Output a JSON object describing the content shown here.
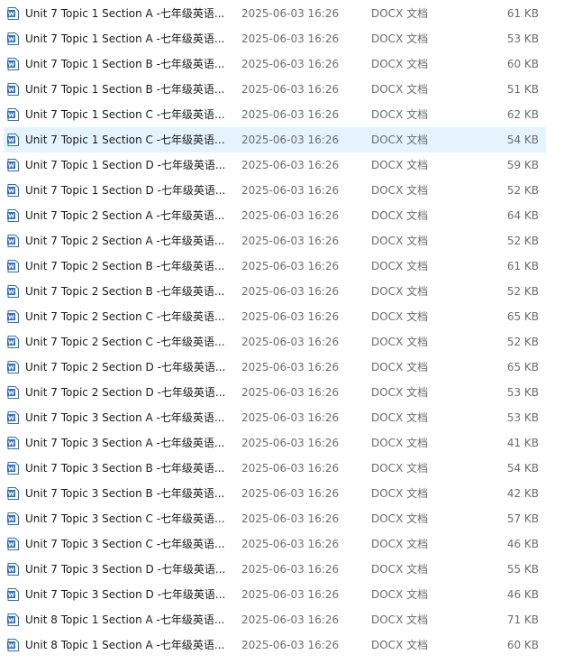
{
  "file_icon": "word-document-icon",
  "colors": {
    "selected_row": "#e5f3ff",
    "word_icon_blue": "#2b6cc4"
  },
  "files": [
    {
      "name": "Unit 7 Topic 1 Section A -七年级英语...",
      "date": "2025-06-03 16:26",
      "type": "DOCX 文档",
      "size": "61 KB",
      "selected": false
    },
    {
      "name": "Unit 7 Topic 1 Section A -七年级英语...",
      "date": "2025-06-03 16:26",
      "type": "DOCX 文档",
      "size": "53 KB",
      "selected": false
    },
    {
      "name": "Unit 7 Topic 1 Section B -七年级英语...",
      "date": "2025-06-03 16:26",
      "type": "DOCX 文档",
      "size": "60 KB",
      "selected": false
    },
    {
      "name": "Unit 7 Topic 1 Section B -七年级英语...",
      "date": "2025-06-03 16:26",
      "type": "DOCX 文档",
      "size": "51 KB",
      "selected": false
    },
    {
      "name": "Unit 7 Topic 1 Section C -七年级英语...",
      "date": "2025-06-03 16:26",
      "type": "DOCX 文档",
      "size": "62 KB",
      "selected": false
    },
    {
      "name": "Unit 7 Topic 1 Section C -七年级英语...",
      "date": "2025-06-03 16:26",
      "type": "DOCX 文档",
      "size": "54 KB",
      "selected": true
    },
    {
      "name": "Unit 7 Topic 1 Section D -七年级英语...",
      "date": "2025-06-03 16:26",
      "type": "DOCX 文档",
      "size": "59 KB",
      "selected": false
    },
    {
      "name": "Unit 7 Topic 1 Section D -七年级英语...",
      "date": "2025-06-03 16:26",
      "type": "DOCX 文档",
      "size": "52 KB",
      "selected": false
    },
    {
      "name": "Unit 7 Topic 2 Section A -七年级英语...",
      "date": "2025-06-03 16:26",
      "type": "DOCX 文档",
      "size": "64 KB",
      "selected": false
    },
    {
      "name": "Unit 7 Topic 2 Section A -七年级英语...",
      "date": "2025-06-03 16:26",
      "type": "DOCX 文档",
      "size": "52 KB",
      "selected": false
    },
    {
      "name": "Unit 7 Topic 2 Section B -七年级英语...",
      "date": "2025-06-03 16:26",
      "type": "DOCX 文档",
      "size": "61 KB",
      "selected": false
    },
    {
      "name": "Unit 7 Topic 2 Section B -七年级英语...",
      "date": "2025-06-03 16:26",
      "type": "DOCX 文档",
      "size": "52 KB",
      "selected": false
    },
    {
      "name": "Unit 7 Topic 2 Section C -七年级英语...",
      "date": "2025-06-03 16:26",
      "type": "DOCX 文档",
      "size": "65 KB",
      "selected": false
    },
    {
      "name": "Unit 7 Topic 2 Section C -七年级英语...",
      "date": "2025-06-03 16:26",
      "type": "DOCX 文档",
      "size": "52 KB",
      "selected": false
    },
    {
      "name": "Unit 7 Topic 2 Section D -七年级英语...",
      "date": "2025-06-03 16:26",
      "type": "DOCX 文档",
      "size": "65 KB",
      "selected": false
    },
    {
      "name": "Unit 7 Topic 2 Section D -七年级英语...",
      "date": "2025-06-03 16:26",
      "type": "DOCX 文档",
      "size": "53 KB",
      "selected": false
    },
    {
      "name": "Unit 7 Topic 3 Section A -七年级英语...",
      "date": "2025-06-03 16:26",
      "type": "DOCX 文档",
      "size": "53 KB",
      "selected": false
    },
    {
      "name": "Unit 7 Topic 3 Section A -七年级英语...",
      "date": "2025-06-03 16:26",
      "type": "DOCX 文档",
      "size": "41 KB",
      "selected": false
    },
    {
      "name": "Unit 7 Topic 3 Section B -七年级英语...",
      "date": "2025-06-03 16:26",
      "type": "DOCX 文档",
      "size": "54 KB",
      "selected": false
    },
    {
      "name": "Unit 7 Topic 3 Section B -七年级英语...",
      "date": "2025-06-03 16:26",
      "type": "DOCX 文档",
      "size": "42 KB",
      "selected": false
    },
    {
      "name": "Unit 7 Topic 3 Section C -七年级英语...",
      "date": "2025-06-03 16:26",
      "type": "DOCX 文档",
      "size": "57 KB",
      "selected": false
    },
    {
      "name": "Unit 7 Topic 3 Section C -七年级英语...",
      "date": "2025-06-03 16:26",
      "type": "DOCX 文档",
      "size": "46 KB",
      "selected": false
    },
    {
      "name": "Unit 7 Topic 3 Section D -七年级英语...",
      "date": "2025-06-03 16:26",
      "type": "DOCX 文档",
      "size": "55 KB",
      "selected": false
    },
    {
      "name": "Unit 7 Topic 3 Section D -七年级英语...",
      "date": "2025-06-03 16:26",
      "type": "DOCX 文档",
      "size": "46 KB",
      "selected": false
    },
    {
      "name": "Unit 8 Topic 1 Section A -七年级英语...",
      "date": "2025-06-03 16:26",
      "type": "DOCX 文档",
      "size": "71 KB",
      "selected": false
    },
    {
      "name": "Unit 8 Topic 1 Section A -七年级英语...",
      "date": "2025-06-03 16:26",
      "type": "DOCX 文档",
      "size": "60 KB",
      "selected": false
    }
  ]
}
